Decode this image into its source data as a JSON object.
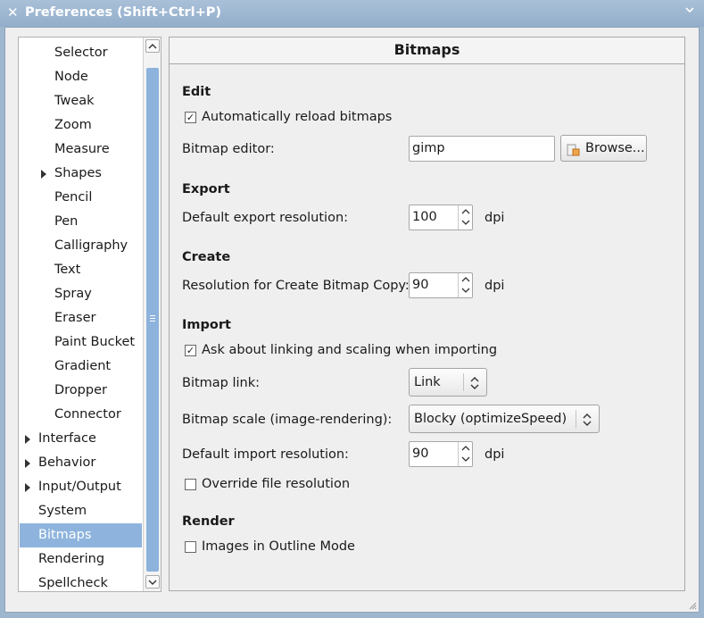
{
  "window": {
    "title": "Preferences (Shift+Ctrl+P)",
    "close_glyph": "✕",
    "menu_glyph": "⌄"
  },
  "sidebar": {
    "items": [
      {
        "label": "Selector",
        "level": 1,
        "expander": false
      },
      {
        "label": "Node",
        "level": 1,
        "expander": false
      },
      {
        "label": "Tweak",
        "level": 1,
        "expander": false
      },
      {
        "label": "Zoom",
        "level": 1,
        "expander": false
      },
      {
        "label": "Measure",
        "level": 1,
        "expander": false
      },
      {
        "label": "Shapes",
        "level": 1,
        "expander": true
      },
      {
        "label": "Pencil",
        "level": 1,
        "expander": false
      },
      {
        "label": "Pen",
        "level": 1,
        "expander": false
      },
      {
        "label": "Calligraphy",
        "level": 1,
        "expander": false
      },
      {
        "label": "Text",
        "level": 1,
        "expander": false
      },
      {
        "label": "Spray",
        "level": 1,
        "expander": false
      },
      {
        "label": "Eraser",
        "level": 1,
        "expander": false
      },
      {
        "label": "Paint Bucket",
        "level": 1,
        "expander": false
      },
      {
        "label": "Gradient",
        "level": 1,
        "expander": false
      },
      {
        "label": "Dropper",
        "level": 1,
        "expander": false
      },
      {
        "label": "Connector",
        "level": 1,
        "expander": false
      },
      {
        "label": "Interface",
        "level": 0,
        "expander": true
      },
      {
        "label": "Behavior",
        "level": 0,
        "expander": true
      },
      {
        "label": "Input/Output",
        "level": 0,
        "expander": true
      },
      {
        "label": "System",
        "level": 0,
        "expander": false
      },
      {
        "label": "Bitmaps",
        "level": 0,
        "expander": false,
        "selected": true
      },
      {
        "label": "Rendering",
        "level": 0,
        "expander": false
      },
      {
        "label": "Spellcheck",
        "level": 0,
        "expander": false
      }
    ]
  },
  "panel": {
    "title": "Bitmaps",
    "edit": {
      "heading": "Edit",
      "auto_reload_label": "Automatically reload bitmaps",
      "auto_reload_checked": true,
      "editor_label": "Bitmap editor:",
      "editor_value": "gimp",
      "browse_label": "Browse..."
    },
    "export": {
      "heading": "Export",
      "resolution_label": "Default export resolution:",
      "resolution_value": "100",
      "unit": "dpi"
    },
    "create": {
      "heading": "Create",
      "resolution_label": "Resolution for Create Bitmap Copy:",
      "resolution_value": "90",
      "unit": "dpi"
    },
    "import": {
      "heading": "Import",
      "ask_label": "Ask about linking and scaling when importing",
      "ask_checked": true,
      "link_label": "Bitmap link:",
      "link_value": "Link",
      "scale_label": "Bitmap scale (image-rendering):",
      "scale_value": "Blocky (optimizeSpeed)",
      "resolution_label": "Default import resolution:",
      "resolution_value": "90",
      "unit": "dpi",
      "override_label": "Override file resolution",
      "override_checked": false
    },
    "render": {
      "heading": "Render",
      "outline_label": "Images in Outline Mode",
      "outline_checked": false
    }
  },
  "colors": {
    "selection": "#8eb4dd",
    "titlebar": "#9fb6cf"
  }
}
